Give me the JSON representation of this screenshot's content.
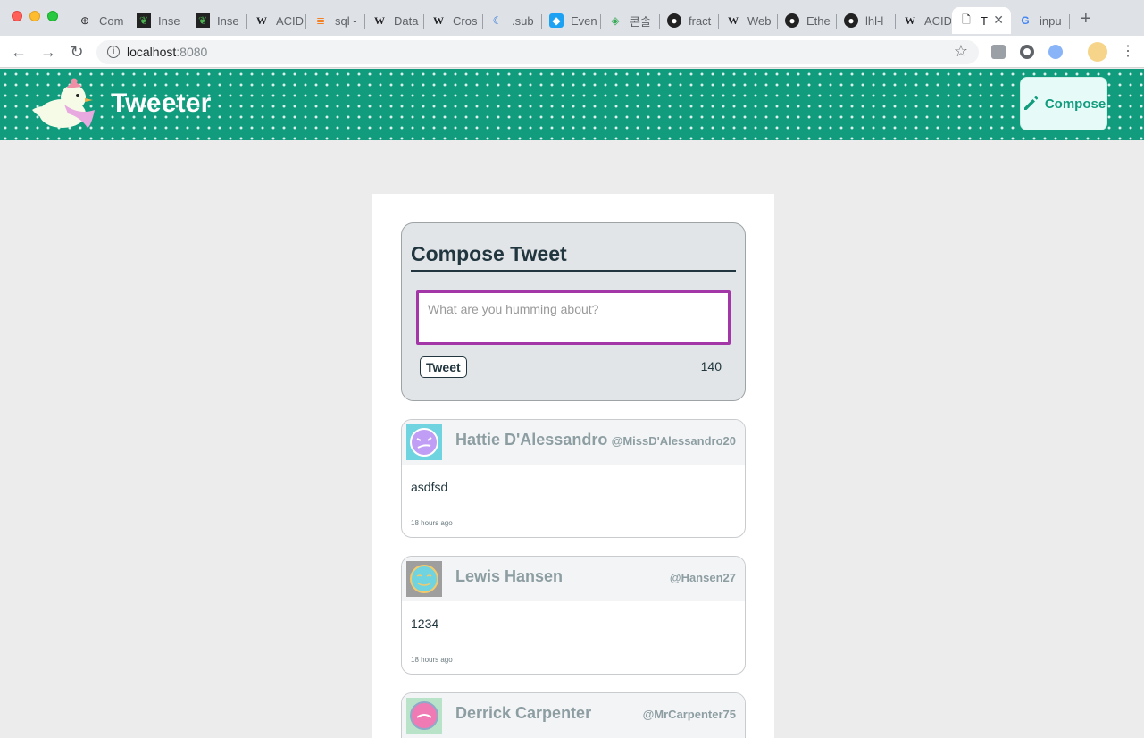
{
  "browser": {
    "tabs": [
      {
        "title": "Com",
        "icon": "plus-circle-icon"
      },
      {
        "title": "Inse",
        "icon": "mongodb-icon"
      },
      {
        "title": "Inse",
        "icon": "mongodb-icon"
      },
      {
        "title": "ACID",
        "icon": "wikipedia-icon"
      },
      {
        "title": "sql -",
        "icon": "stackoverflow-icon"
      },
      {
        "title": "Data",
        "icon": "wikipedia-icon"
      },
      {
        "title": "Cros",
        "icon": "wikipedia-icon"
      },
      {
        "title": ".sub",
        "icon": "moon-icon"
      },
      {
        "title": "Even",
        "icon": "bird-icon"
      },
      {
        "title": "콘솔",
        "icon": "google-cloud-icon"
      },
      {
        "title": "fract",
        "icon": "github-icon"
      },
      {
        "title": "Web",
        "icon": "wikipedia-icon"
      },
      {
        "title": "Ethe",
        "icon": "github-icon"
      },
      {
        "title": "lhl-l",
        "icon": "github-icon"
      },
      {
        "title": "ACID",
        "icon": "wikipedia-icon"
      },
      {
        "title": "T",
        "icon": "document-icon",
        "active": true
      },
      {
        "title": "inpu",
        "icon": "google-icon"
      }
    ],
    "url_host": "localhost",
    "url_port": ":8080"
  },
  "app": {
    "title": "Tweeter",
    "compose_label": "Compose",
    "accent": "#119c7e"
  },
  "compose": {
    "heading": "Compose Tweet",
    "placeholder": "What are you humming about?",
    "submit_label": "Tweet",
    "counter": "140"
  },
  "tweets": [
    {
      "name": "Hattie D'Alessandro",
      "handle": "@MissD'Alessandro20",
      "text": "asdfsd",
      "time": "18 hours ago"
    },
    {
      "name": "Lewis Hansen",
      "handle": "@Hansen27",
      "text": "1234",
      "time": "18 hours ago"
    },
    {
      "name": "Derrick Carpenter",
      "handle": "@MrCarpenter75",
      "text": "",
      "time": ""
    }
  ]
}
